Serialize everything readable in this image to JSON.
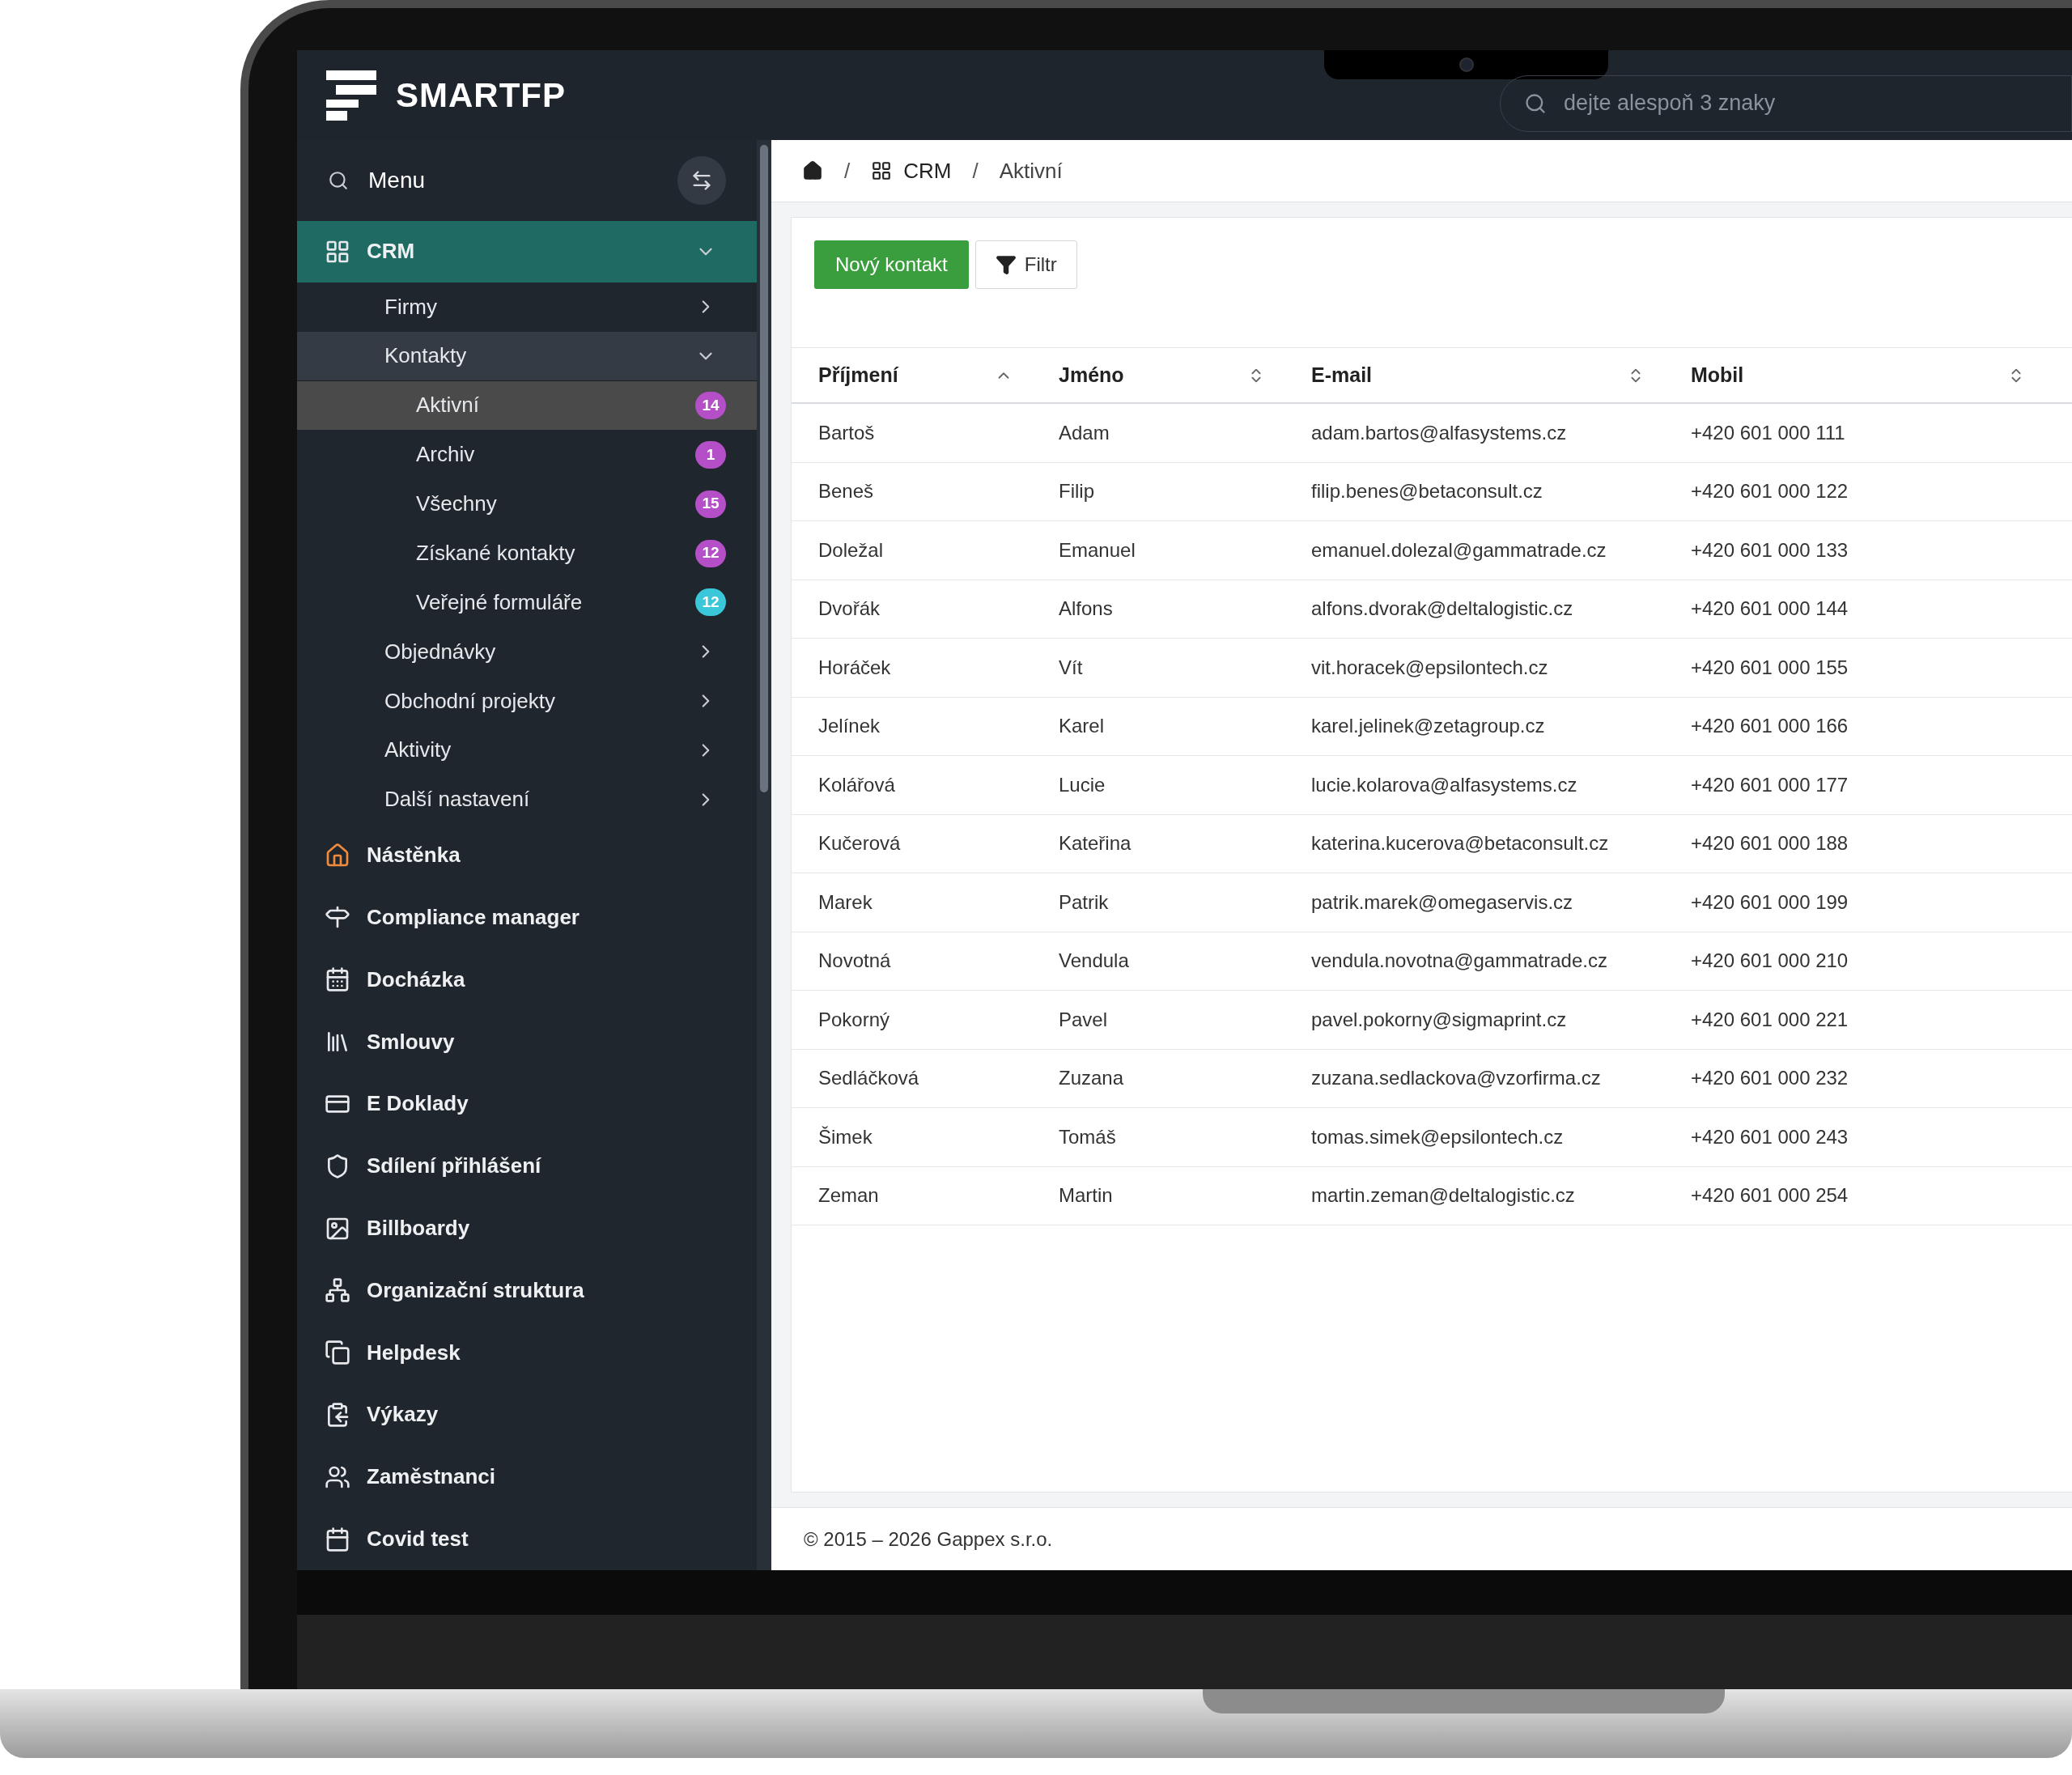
{
  "header": {
    "logo": "SMARTFP",
    "search": {
      "placeholder": "dejte alespoň 3 znaky"
    }
  },
  "sidebar": {
    "search_label": "Menu",
    "items": [
      {
        "label": "CRM",
        "selected": true,
        "expanded": true,
        "children": [
          {
            "label": "Firmy",
            "expanded": false
          },
          {
            "label": "Kontakty",
            "expanded": true,
            "children": [
              {
                "label": "Aktivní",
                "selected": true,
                "badge": "14",
                "color": "#b44fc8"
              },
              {
                "label": "Archiv",
                "selected": false,
                "badge": "1",
                "color": "#b44fc8"
              },
              {
                "label": "Všechny",
                "selected": false,
                "badge": "15",
                "color": "#b44fc8"
              },
              {
                "label": "Získané kontakty",
                "selected": false,
                "badge": "12",
                "color": "#b44fc8"
              },
              {
                "label": "Veřejné formuláře",
                "selected": false,
                "badge": "12",
                "color": "#3ac7d9"
              }
            ]
          },
          {
            "label": "Objednávky",
            "expanded": false
          },
          {
            "label": "Obchodní projekty",
            "expanded": false
          },
          {
            "label": "Aktivity",
            "expanded": false
          },
          {
            "label": "Další nastavení",
            "expanded": false
          }
        ]
      },
      {
        "label": "Nástěnka",
        "selected": false
      },
      {
        "label": "Compliance manager",
        "selected": false
      },
      {
        "label": "Docházka",
        "selected": false
      },
      {
        "label": "Smlouvy",
        "selected": false
      },
      {
        "label": "E Doklady",
        "selected": false
      },
      {
        "label": "Sdílení přihlášení",
        "selected": false
      },
      {
        "label": "Billboardy",
        "selected": false
      },
      {
        "label": "Organizační struktura",
        "selected": false
      },
      {
        "label": "Helpdesk",
        "selected": false
      },
      {
        "label": "Výkazy",
        "selected": false
      },
      {
        "label": "Zaměstnanci",
        "selected": false
      },
      {
        "label": "Covid test",
        "selected": false
      }
    ]
  },
  "breadcrumb": [
    {
      "kind": "home"
    },
    {
      "kind": "separator",
      "text": "/"
    },
    {
      "kind": "link",
      "label": "CRM"
    },
    {
      "kind": "separator",
      "text": "/"
    },
    {
      "kind": "current",
      "label": "Aktivní"
    }
  ],
  "toolbar": {
    "primary": "Nový kontakt",
    "filter": "Filtr"
  },
  "table": {
    "columns": [
      {
        "label": "Příjmení",
        "sorted": true
      },
      {
        "label": "Jméno",
        "sorted": false
      },
      {
        "label": "E-mail",
        "sorted": false
      },
      {
        "label": "Mobil",
        "sorted": false
      }
    ],
    "rows": [
      [
        "Bartoš",
        "Adam",
        "adam.bartos@alfasystems.cz",
        "+420 601 000 111"
      ],
      [
        "Beneš",
        "Filip",
        "filip.benes@betaconsult.cz",
        "+420 601 000 122"
      ],
      [
        "Doležal",
        "Emanuel",
        "emanuel.dolezal@gammatrade.cz",
        "+420 601 000 133"
      ],
      [
        "Dvořák",
        "Alfons",
        "alfons.dvorak@deltalogistic.cz",
        "+420 601 000 144"
      ],
      [
        "Horáček",
        "Vít",
        "vit.horacek@epsilontech.cz",
        "+420 601 000 155"
      ],
      [
        "Jelínek",
        "Karel",
        "karel.jelinek@zetagroup.cz",
        "+420 601 000 166"
      ],
      [
        "Kolářová",
        "Lucie",
        "lucie.kolarova@alfasystems.cz",
        "+420 601 000 177"
      ],
      [
        "Kučerová",
        "Kateřina",
        "katerina.kucerova@betaconsult.cz",
        "+420 601 000 188"
      ],
      [
        "Marek",
        "Patrik",
        "patrik.marek@omegaservis.cz",
        "+420 601 000 199"
      ],
      [
        "Novotná",
        "Vendula",
        "vendula.novotna@gammatrade.cz",
        "+420 601 000 210"
      ],
      [
        "Pokorný",
        "Pavel",
        "pavel.pokorny@sigmaprint.cz",
        "+420 601 000 221"
      ],
      [
        "Sedláčková",
        "Zuzana",
        "zuzana.sedlackova@vzorfirma.cz",
        "+420 601 000 232"
      ],
      [
        "Šimek",
        "Tomáš",
        "tomas.simek@epsilontech.cz",
        "+420 601 000 243"
      ],
      [
        "Zeman",
        "Martin",
        "martin.zeman@deltalogistic.cz",
        "+420 601 000 254"
      ]
    ]
  },
  "footer": "© 2015 – 2026 Gappex s.r.o."
}
